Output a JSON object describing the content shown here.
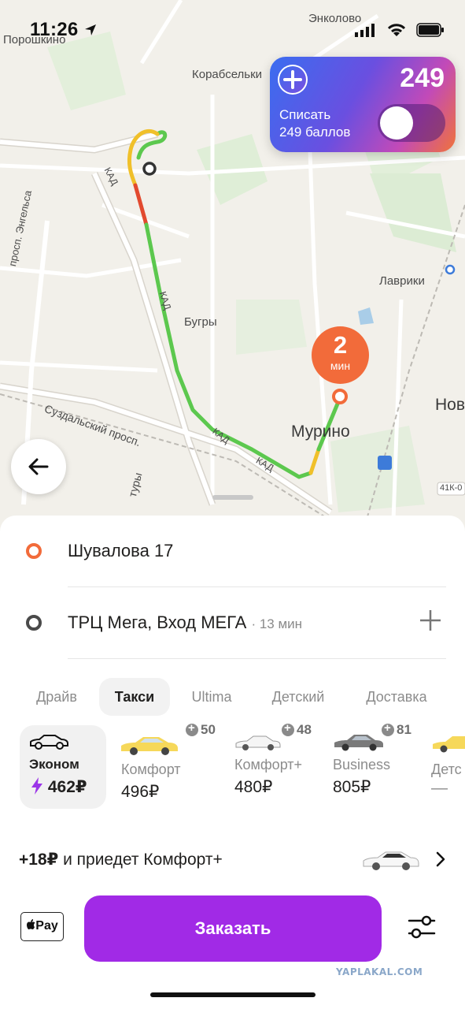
{
  "status_bar": {
    "time": "11:26"
  },
  "map": {
    "labels": {
      "poroshkino": "Порошкино",
      "enkolovo": "Энколово",
      "korabselki": "Корабсельки",
      "lavriki": "Лаврики",
      "bugry": "Бугры",
      "murino": "Мурино",
      "nov": "Нов",
      "engelsa": "просп. Энгельса",
      "suzdalsky": "Суздальский просп.",
      "kad1": "КАД",
      "kad2": "КАД",
      "kad3": "КАД",
      "kad4": "КАД",
      "tury": "туры",
      "road_41k": "41К-0"
    }
  },
  "plus_card": {
    "points": "249",
    "line1": "Списать",
    "line2": "249 баллов",
    "toggle_on": false
  },
  "eta": {
    "value": "2",
    "unit": "мин"
  },
  "route": {
    "from": "Шувалова 17",
    "to": "ТРЦ Мега, Вход МЕГА",
    "to_eta": "· 13 мин"
  },
  "tabs": [
    {
      "label": "Драйв"
    },
    {
      "label": "Такси",
      "active": true
    },
    {
      "label": "Ultima"
    },
    {
      "label": "Детский"
    },
    {
      "label": "Доставка"
    }
  ],
  "tariffs": [
    {
      "name": "Эконом",
      "price": "462₽",
      "selected": true
    },
    {
      "name": "Комфорт",
      "price": "496₽",
      "bonus": "50"
    },
    {
      "name": "Комфорт+",
      "price": "480₽",
      "bonus": "48"
    },
    {
      "name": "Business",
      "price": "805₽",
      "bonus": "81"
    },
    {
      "name": "Детс",
      "price": "—"
    }
  ],
  "upsell": {
    "amount": "+18₽",
    "text": "и приедет Комфорт+"
  },
  "payment": {
    "apple_pay": "Pay"
  },
  "order_button": "Заказать",
  "watermark": "YAPLAKAL.COM",
  "colors": {
    "order": "#a12ae6",
    "route_green": "#5cc84e",
    "route_yellow": "#f0c02a",
    "route_red": "#e24a2f",
    "eta": "#f26b3a"
  }
}
